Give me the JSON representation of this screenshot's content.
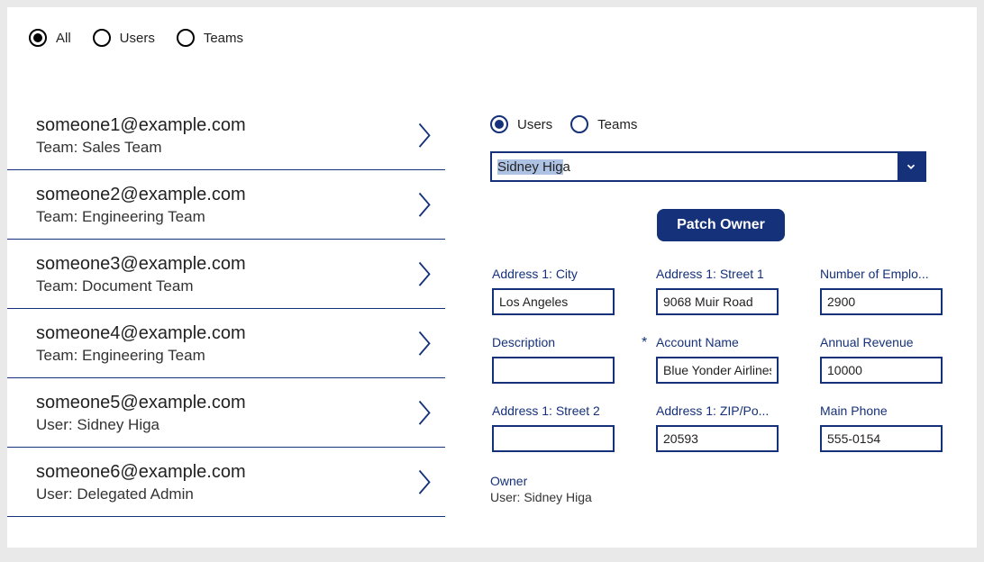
{
  "top_filter": {
    "options": [
      {
        "label": "All",
        "selected": true
      },
      {
        "label": "Users",
        "selected": false
      },
      {
        "label": "Teams",
        "selected": false
      }
    ]
  },
  "list": [
    {
      "primary": "someone1@example.com",
      "secondary": "Team: Sales Team"
    },
    {
      "primary": "someone2@example.com",
      "secondary": "Team: Engineering Team"
    },
    {
      "primary": "someone3@example.com",
      "secondary": "Team: Document Team"
    },
    {
      "primary": "someone4@example.com",
      "secondary": "Team: Engineering Team"
    },
    {
      "primary": "someone5@example.com",
      "secondary": "User: Sidney Higa"
    },
    {
      "primary": "someone6@example.com",
      "secondary": "User: Delegated Admin"
    }
  ],
  "right_filter": {
    "options": [
      {
        "label": "Users",
        "selected": true
      },
      {
        "label": "Teams",
        "selected": false
      }
    ]
  },
  "combo": {
    "highlighted": "Sidney Hig",
    "rest": "a"
  },
  "button_label": "Patch Owner",
  "fields": [
    {
      "label": "Address 1: City",
      "value": "Los Angeles",
      "required": false
    },
    {
      "label": "Address 1: Street 1",
      "value": "9068 Muir Road",
      "required": false
    },
    {
      "label": "Number of Emplo...",
      "value": "2900",
      "required": false
    },
    {
      "label": "Description",
      "value": "",
      "required": false
    },
    {
      "label": "Account Name",
      "value": "Blue Yonder Airlines",
      "required": true
    },
    {
      "label": "Annual Revenue",
      "value": "10000",
      "required": false
    },
    {
      "label": "Address 1: Street 2",
      "value": "",
      "required": false
    },
    {
      "label": "Address 1: ZIP/Po...",
      "value": "20593",
      "required": false
    },
    {
      "label": "Main Phone",
      "value": "555-0154",
      "required": false
    }
  ],
  "owner": {
    "label": "Owner",
    "value": "User: Sidney Higa"
  }
}
